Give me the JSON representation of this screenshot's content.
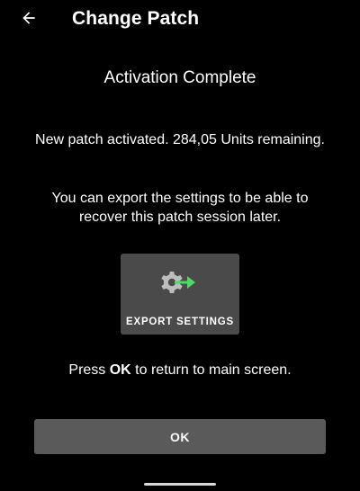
{
  "header": {
    "back_icon": "arrow-left-icon",
    "title": "Change Patch"
  },
  "content": {
    "title": "Activation Complete",
    "status_message": "New patch activated. 284,05 Units remaining.",
    "export_message": "You can export the settings to be able to recover this patch session later.",
    "export_tile": {
      "icon": "gear-export-icon",
      "label": "EXPORT SETTINGS"
    },
    "press_prefix": "Press ",
    "press_bold": "OK",
    "press_suffix": " to return to main screen."
  },
  "footer": {
    "ok_label": "OK"
  },
  "colors": {
    "background": "#000000",
    "tile": "#4a4a4a",
    "button": "#5a5a5a",
    "icon_gray": "#bdbdbd",
    "icon_accent": "#4cd964"
  }
}
